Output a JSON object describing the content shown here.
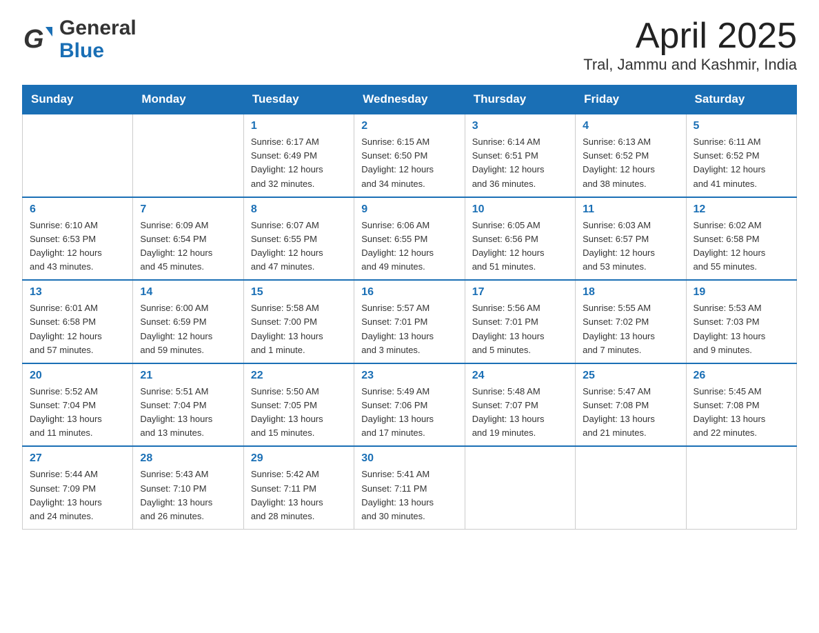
{
  "header": {
    "logo_line1": "General",
    "logo_line2": "Blue",
    "title": "April 2025",
    "subtitle": "Tral, Jammu and Kashmir, India"
  },
  "calendar": {
    "days_of_week": [
      "Sunday",
      "Monday",
      "Tuesday",
      "Wednesday",
      "Thursday",
      "Friday",
      "Saturday"
    ],
    "weeks": [
      [
        {
          "day": "",
          "info": ""
        },
        {
          "day": "",
          "info": ""
        },
        {
          "day": "1",
          "info": "Sunrise: 6:17 AM\nSunset: 6:49 PM\nDaylight: 12 hours\nand 32 minutes."
        },
        {
          "day": "2",
          "info": "Sunrise: 6:15 AM\nSunset: 6:50 PM\nDaylight: 12 hours\nand 34 minutes."
        },
        {
          "day": "3",
          "info": "Sunrise: 6:14 AM\nSunset: 6:51 PM\nDaylight: 12 hours\nand 36 minutes."
        },
        {
          "day": "4",
          "info": "Sunrise: 6:13 AM\nSunset: 6:52 PM\nDaylight: 12 hours\nand 38 minutes."
        },
        {
          "day": "5",
          "info": "Sunrise: 6:11 AM\nSunset: 6:52 PM\nDaylight: 12 hours\nand 41 minutes."
        }
      ],
      [
        {
          "day": "6",
          "info": "Sunrise: 6:10 AM\nSunset: 6:53 PM\nDaylight: 12 hours\nand 43 minutes."
        },
        {
          "day": "7",
          "info": "Sunrise: 6:09 AM\nSunset: 6:54 PM\nDaylight: 12 hours\nand 45 minutes."
        },
        {
          "day": "8",
          "info": "Sunrise: 6:07 AM\nSunset: 6:55 PM\nDaylight: 12 hours\nand 47 minutes."
        },
        {
          "day": "9",
          "info": "Sunrise: 6:06 AM\nSunset: 6:55 PM\nDaylight: 12 hours\nand 49 minutes."
        },
        {
          "day": "10",
          "info": "Sunrise: 6:05 AM\nSunset: 6:56 PM\nDaylight: 12 hours\nand 51 minutes."
        },
        {
          "day": "11",
          "info": "Sunrise: 6:03 AM\nSunset: 6:57 PM\nDaylight: 12 hours\nand 53 minutes."
        },
        {
          "day": "12",
          "info": "Sunrise: 6:02 AM\nSunset: 6:58 PM\nDaylight: 12 hours\nand 55 minutes."
        }
      ],
      [
        {
          "day": "13",
          "info": "Sunrise: 6:01 AM\nSunset: 6:58 PM\nDaylight: 12 hours\nand 57 minutes."
        },
        {
          "day": "14",
          "info": "Sunrise: 6:00 AM\nSunset: 6:59 PM\nDaylight: 12 hours\nand 59 minutes."
        },
        {
          "day": "15",
          "info": "Sunrise: 5:58 AM\nSunset: 7:00 PM\nDaylight: 13 hours\nand 1 minute."
        },
        {
          "day": "16",
          "info": "Sunrise: 5:57 AM\nSunset: 7:01 PM\nDaylight: 13 hours\nand 3 minutes."
        },
        {
          "day": "17",
          "info": "Sunrise: 5:56 AM\nSunset: 7:01 PM\nDaylight: 13 hours\nand 5 minutes."
        },
        {
          "day": "18",
          "info": "Sunrise: 5:55 AM\nSunset: 7:02 PM\nDaylight: 13 hours\nand 7 minutes."
        },
        {
          "day": "19",
          "info": "Sunrise: 5:53 AM\nSunset: 7:03 PM\nDaylight: 13 hours\nand 9 minutes."
        }
      ],
      [
        {
          "day": "20",
          "info": "Sunrise: 5:52 AM\nSunset: 7:04 PM\nDaylight: 13 hours\nand 11 minutes."
        },
        {
          "day": "21",
          "info": "Sunrise: 5:51 AM\nSunset: 7:04 PM\nDaylight: 13 hours\nand 13 minutes."
        },
        {
          "day": "22",
          "info": "Sunrise: 5:50 AM\nSunset: 7:05 PM\nDaylight: 13 hours\nand 15 minutes."
        },
        {
          "day": "23",
          "info": "Sunrise: 5:49 AM\nSunset: 7:06 PM\nDaylight: 13 hours\nand 17 minutes."
        },
        {
          "day": "24",
          "info": "Sunrise: 5:48 AM\nSunset: 7:07 PM\nDaylight: 13 hours\nand 19 minutes."
        },
        {
          "day": "25",
          "info": "Sunrise: 5:47 AM\nSunset: 7:08 PM\nDaylight: 13 hours\nand 21 minutes."
        },
        {
          "day": "26",
          "info": "Sunrise: 5:45 AM\nSunset: 7:08 PM\nDaylight: 13 hours\nand 22 minutes."
        }
      ],
      [
        {
          "day": "27",
          "info": "Sunrise: 5:44 AM\nSunset: 7:09 PM\nDaylight: 13 hours\nand 24 minutes."
        },
        {
          "day": "28",
          "info": "Sunrise: 5:43 AM\nSunset: 7:10 PM\nDaylight: 13 hours\nand 26 minutes."
        },
        {
          "day": "29",
          "info": "Sunrise: 5:42 AM\nSunset: 7:11 PM\nDaylight: 13 hours\nand 28 minutes."
        },
        {
          "day": "30",
          "info": "Sunrise: 5:41 AM\nSunset: 7:11 PM\nDaylight: 13 hours\nand 30 minutes."
        },
        {
          "day": "",
          "info": ""
        },
        {
          "day": "",
          "info": ""
        },
        {
          "day": "",
          "info": ""
        }
      ]
    ]
  }
}
